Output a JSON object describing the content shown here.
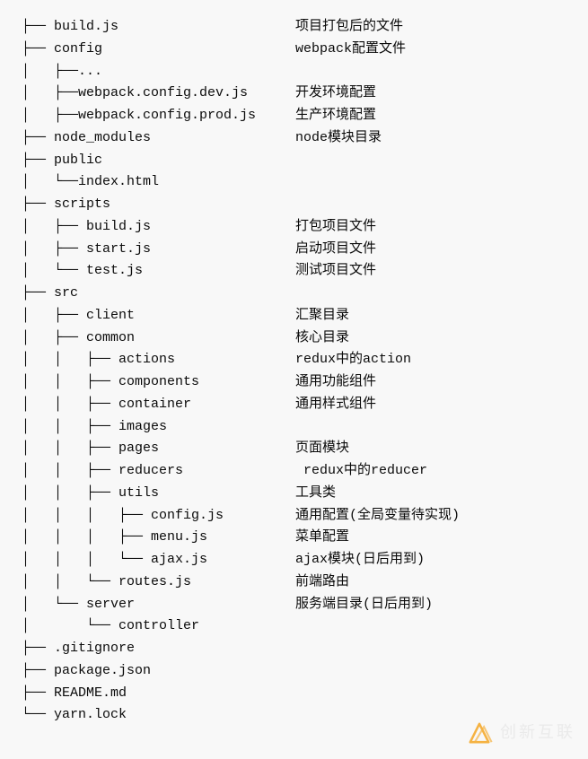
{
  "rows": [
    {
      "tree": "├── build.js",
      "desc": "项目打包后的文件"
    },
    {
      "tree": "├── config",
      "desc": "webpack配置文件"
    },
    {
      "tree": "│   ├──...",
      "desc": ""
    },
    {
      "tree": "│   ├──webpack.config.dev.js",
      "desc": "开发环境配置"
    },
    {
      "tree": "│   ├──webpack.config.prod.js",
      "desc": "生产环境配置"
    },
    {
      "tree": "├── node_modules",
      "desc": "node模块目录"
    },
    {
      "tree": "├── public",
      "desc": ""
    },
    {
      "tree": "│   └──index.html",
      "desc": ""
    },
    {
      "tree": "├── scripts",
      "desc": ""
    },
    {
      "tree": "│   ├── build.js",
      "desc": "打包项目文件"
    },
    {
      "tree": "│   ├── start.js",
      "desc": "启动项目文件"
    },
    {
      "tree": "│   └── test.js",
      "desc": "测试项目文件"
    },
    {
      "tree": "├── src",
      "desc": ""
    },
    {
      "tree": "│   ├── client",
      "desc": "汇聚目录"
    },
    {
      "tree": "│   ├── common",
      "desc": "核心目录"
    },
    {
      "tree": "│   │   ├── actions",
      "desc": "redux中的action"
    },
    {
      "tree": "│   │   ├── components",
      "desc": "通用功能组件"
    },
    {
      "tree": "│   │   ├── container",
      "desc": "通用样式组件"
    },
    {
      "tree": "│   │   ├── images",
      "desc": ""
    },
    {
      "tree": "│   │   ├── pages",
      "desc": "页面模块"
    },
    {
      "tree": "│   │   ├── reducers",
      "desc": " redux中的reducer"
    },
    {
      "tree": "│   │   ├── utils",
      "desc": "工具类"
    },
    {
      "tree": "│   │   │   ├── config.js",
      "desc": "通用配置(全局变量待实现)"
    },
    {
      "tree": "│   │   │   ├── menu.js",
      "desc": "菜单配置"
    },
    {
      "tree": "│   │   │   └── ajax.js",
      "desc": "ajax模块(日后用到)"
    },
    {
      "tree": "│   │   └── routes.js",
      "desc": "前端路由"
    },
    {
      "tree": "│   └── server",
      "desc": "服务端目录(日后用到)"
    },
    {
      "tree": "│       └── controller",
      "desc": ""
    },
    {
      "tree": "├── .gitignore",
      "desc": ""
    },
    {
      "tree": "├── package.json",
      "desc": ""
    },
    {
      "tree": "├── README.md",
      "desc": ""
    },
    {
      "tree": "└── yarn.lock",
      "desc": ""
    }
  ],
  "watermark": {
    "text": "创新互联"
  }
}
